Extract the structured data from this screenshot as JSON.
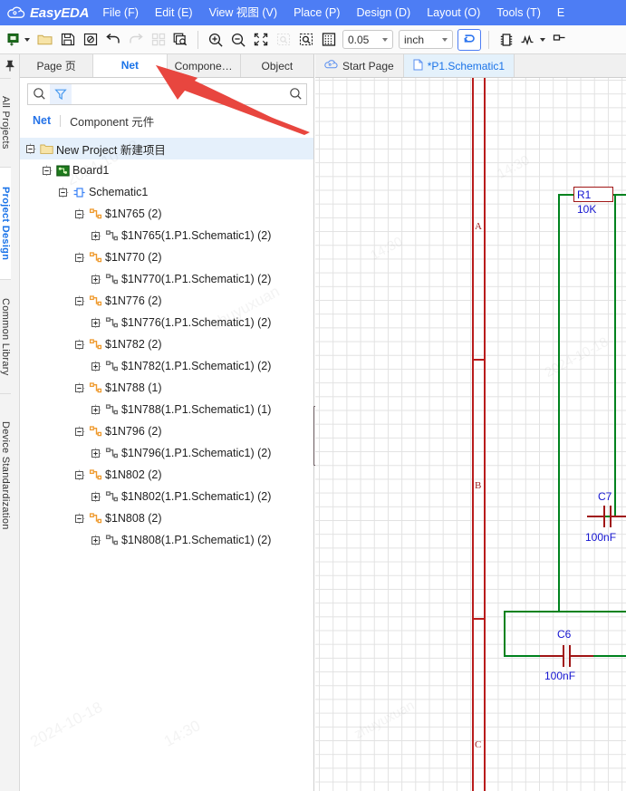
{
  "app": {
    "brand": "EasyEDA",
    "brand_icon": "cloud-icon"
  },
  "menubar": {
    "items": [
      {
        "label": "File (F)"
      },
      {
        "label": "Edit (E)"
      },
      {
        "label": "View 视图 (V)"
      },
      {
        "label": "Place (P)"
      },
      {
        "label": "Design (D)"
      },
      {
        "label": "Layout (O)"
      },
      {
        "label": "Tools (T)"
      },
      {
        "label": "E"
      }
    ]
  },
  "toolbar": {
    "new_icon": "new-document-icon",
    "open_icon": "open-folder-icon",
    "save_icon": "save-icon",
    "save_all_icon": "save-all-icon",
    "undo_icon": "undo-icon",
    "redo_icon": "redo-icon",
    "grid_panels_icon": "panels-icon",
    "find_doc_icon": "find-document-icon",
    "zoom_in_icon": "zoom-in-icon",
    "zoom_out_icon": "zoom-out-icon",
    "fit_icon": "fit-screen-icon",
    "zoom_area_disabled_icon": "zoom-area-icon",
    "zoom_select_icon": "zoom-selection-icon",
    "grid_icon": "grid-icon",
    "snap_value": "0.05",
    "unit_value": "inch",
    "wire_tool_icon": "wire-tool-icon",
    "component_icon": "component-icon",
    "netlabel_icon": "net-label-icon",
    "pin_icon": "pin-icon"
  },
  "rail": {
    "pin_icon": "pin-icon",
    "items": [
      {
        "label": "All Projects",
        "active": false
      },
      {
        "label": "Project Design",
        "active": true
      },
      {
        "label": "Common Library",
        "active": false
      },
      {
        "label": "Device Standardization",
        "active": false
      }
    ]
  },
  "panel": {
    "tabs": [
      {
        "label": "Page 页",
        "active": false
      },
      {
        "label": "Net",
        "active": true
      },
      {
        "label": "Compone…",
        "active": false
      },
      {
        "label": "Object",
        "active": false
      }
    ],
    "search": {
      "value": "",
      "placeholder": "",
      "search_icon": "search-icon",
      "filter_icon": "filter-icon",
      "submit_icon": "search-icon"
    },
    "subtabs": [
      {
        "label": "Net",
        "active": true
      },
      {
        "label": "Component 元件",
        "active": false
      }
    ],
    "tree": [
      {
        "label": "New Project 新建项目",
        "depth": 0,
        "icon": "folder-icon",
        "expander": "minus",
        "selected": true
      },
      {
        "label": "Board1",
        "depth": 1,
        "icon": "board-icon",
        "expander": "minus",
        "selected": false
      },
      {
        "label": "Schematic1",
        "depth": 2,
        "icon": "schematic-icon",
        "expander": "minus",
        "selected": false
      },
      {
        "label": "$1N765 (2)",
        "depth": 3,
        "icon": "net-icon-orange",
        "expander": "minus",
        "selected": false
      },
      {
        "label": "$1N765(1.P1.Schematic1) (2)",
        "depth": 4,
        "icon": "net-icon-gray",
        "expander": "plus",
        "selected": false
      },
      {
        "label": "$1N770 (2)",
        "depth": 3,
        "icon": "net-icon-orange",
        "expander": "minus",
        "selected": false
      },
      {
        "label": "$1N770(1.P1.Schematic1) (2)",
        "depth": 4,
        "icon": "net-icon-gray",
        "expander": "plus",
        "selected": false
      },
      {
        "label": "$1N776 (2)",
        "depth": 3,
        "icon": "net-icon-orange",
        "expander": "minus",
        "selected": false
      },
      {
        "label": "$1N776(1.P1.Schematic1) (2)",
        "depth": 4,
        "icon": "net-icon-gray",
        "expander": "plus",
        "selected": false
      },
      {
        "label": "$1N782 (2)",
        "depth": 3,
        "icon": "net-icon-orange",
        "expander": "minus",
        "selected": false
      },
      {
        "label": "$1N782(1.P1.Schematic1) (2)",
        "depth": 4,
        "icon": "net-icon-gray",
        "expander": "plus",
        "selected": false
      },
      {
        "label": "$1N788 (1)",
        "depth": 3,
        "icon": "net-icon-orange",
        "expander": "minus",
        "selected": false
      },
      {
        "label": "$1N788(1.P1.Schematic1) (1)",
        "depth": 4,
        "icon": "net-icon-gray",
        "expander": "plus",
        "selected": false
      },
      {
        "label": "$1N796 (2)",
        "depth": 3,
        "icon": "net-icon-orange",
        "expander": "minus",
        "selected": false
      },
      {
        "label": "$1N796(1.P1.Schematic1) (2)",
        "depth": 4,
        "icon": "net-icon-gray",
        "expander": "plus",
        "selected": false
      },
      {
        "label": "$1N802 (2)",
        "depth": 3,
        "icon": "net-icon-orange",
        "expander": "minus",
        "selected": false
      },
      {
        "label": "$1N802(1.P1.Schematic1) (2)",
        "depth": 4,
        "icon": "net-icon-gray",
        "expander": "plus",
        "selected": false
      },
      {
        "label": "$1N808 (2)",
        "depth": 3,
        "icon": "net-icon-orange",
        "expander": "minus",
        "selected": false
      },
      {
        "label": "$1N808(1.P1.Schematic1) (2)",
        "depth": 4,
        "icon": "net-icon-gray",
        "expander": "plus",
        "selected": false
      }
    ]
  },
  "editor": {
    "tabs": [
      {
        "label": "Start Page",
        "icon": "cloud-icon",
        "active": false
      },
      {
        "label": "*P1.Schematic1",
        "icon": "document-icon",
        "active": true
      }
    ],
    "frame_letters": [
      "A",
      "B",
      "C"
    ],
    "schematic": {
      "components": [
        {
          "designator": "R1",
          "value": "10K",
          "type": "resistor"
        },
        {
          "designator": "C7",
          "value": "100nF",
          "type": "capacitor"
        },
        {
          "designator": "C6",
          "value": "100nF",
          "type": "capacitor"
        }
      ]
    }
  },
  "colors": {
    "brand_blue": "#4d7df4",
    "accent_blue": "#1a73e8",
    "wire_green": "#00821e",
    "wire_red": "#a01616",
    "label_blue": "#1414d0",
    "frame_red": "#b91c1c",
    "annotation_red": "#e8463f"
  },
  "watermarks": [
    {
      "text": "14:30"
    },
    {
      "text": "2024-10-18"
    },
    {
      "text": "zhuyuxuan"
    }
  ]
}
